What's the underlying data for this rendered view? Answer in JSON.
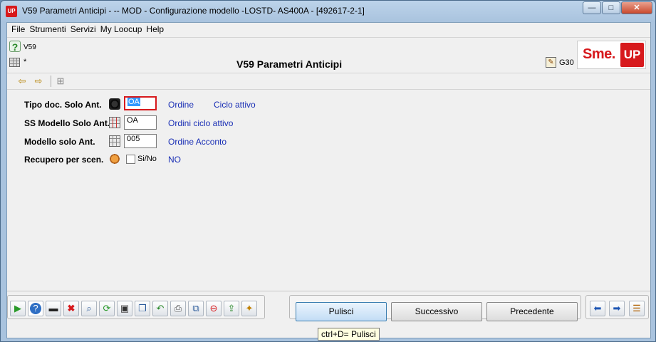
{
  "window": {
    "title": "V59 Parametri Anticipi -  -- MOD - Configurazione modello -LOSTD- AS400A  - [492617-2-1]",
    "app_badge": "UP",
    "minimize_glyph": "—",
    "maximize_glyph": "□",
    "close_glyph": "✕"
  },
  "menu": [
    "File",
    "Strumenti",
    "Servizi",
    "My Loocup",
    "Help"
  ],
  "header": {
    "help_code": "V59",
    "star": "*",
    "title": "V59 Parametri Anticipi",
    "code_right": "G30",
    "logo_sme": "Sme.",
    "logo_up": "UP"
  },
  "toolbar_icons": [
    "nav-back-icon",
    "nav-forward-icon",
    "tree-structure-icon"
  ],
  "form": {
    "rows": [
      {
        "label": "Tipo doc. Solo Ant.",
        "icon": "cube-icon",
        "value": "OA",
        "desc1": "Ordine",
        "desc2": "Ciclo attivo"
      },
      {
        "label": "SS Modello Solo Ant.",
        "icon": "table-red-icon",
        "value": "OA",
        "desc1": "Ordini ciclo attivo"
      },
      {
        "label": "Modello solo Ant.",
        "icon": "table-icon",
        "value": "005",
        "desc1": "Ordine Acconto"
      },
      {
        "label": "Recupero per scen.",
        "icon": "toggle-icon",
        "checkbox_label": "Si/No",
        "checked": false,
        "desc1": "NO"
      }
    ]
  },
  "bottom": {
    "icons_left": [
      "play-icon",
      "help-icon",
      "console-icon",
      "delete-icon",
      "search-icon",
      "refresh-icon",
      "save-icon",
      "copy-icon",
      "undo-icon",
      "print-icon",
      "duplicate-icon",
      "stop-icon",
      "export-icon",
      "wand-icon"
    ],
    "buttons": [
      "Pulisci",
      "Successivo",
      "Precedente"
    ],
    "icons_right": [
      "arrow-left-icon",
      "arrow-right-icon",
      "list-icon"
    ]
  },
  "tooltip": "ctrl+D= Pulisci"
}
